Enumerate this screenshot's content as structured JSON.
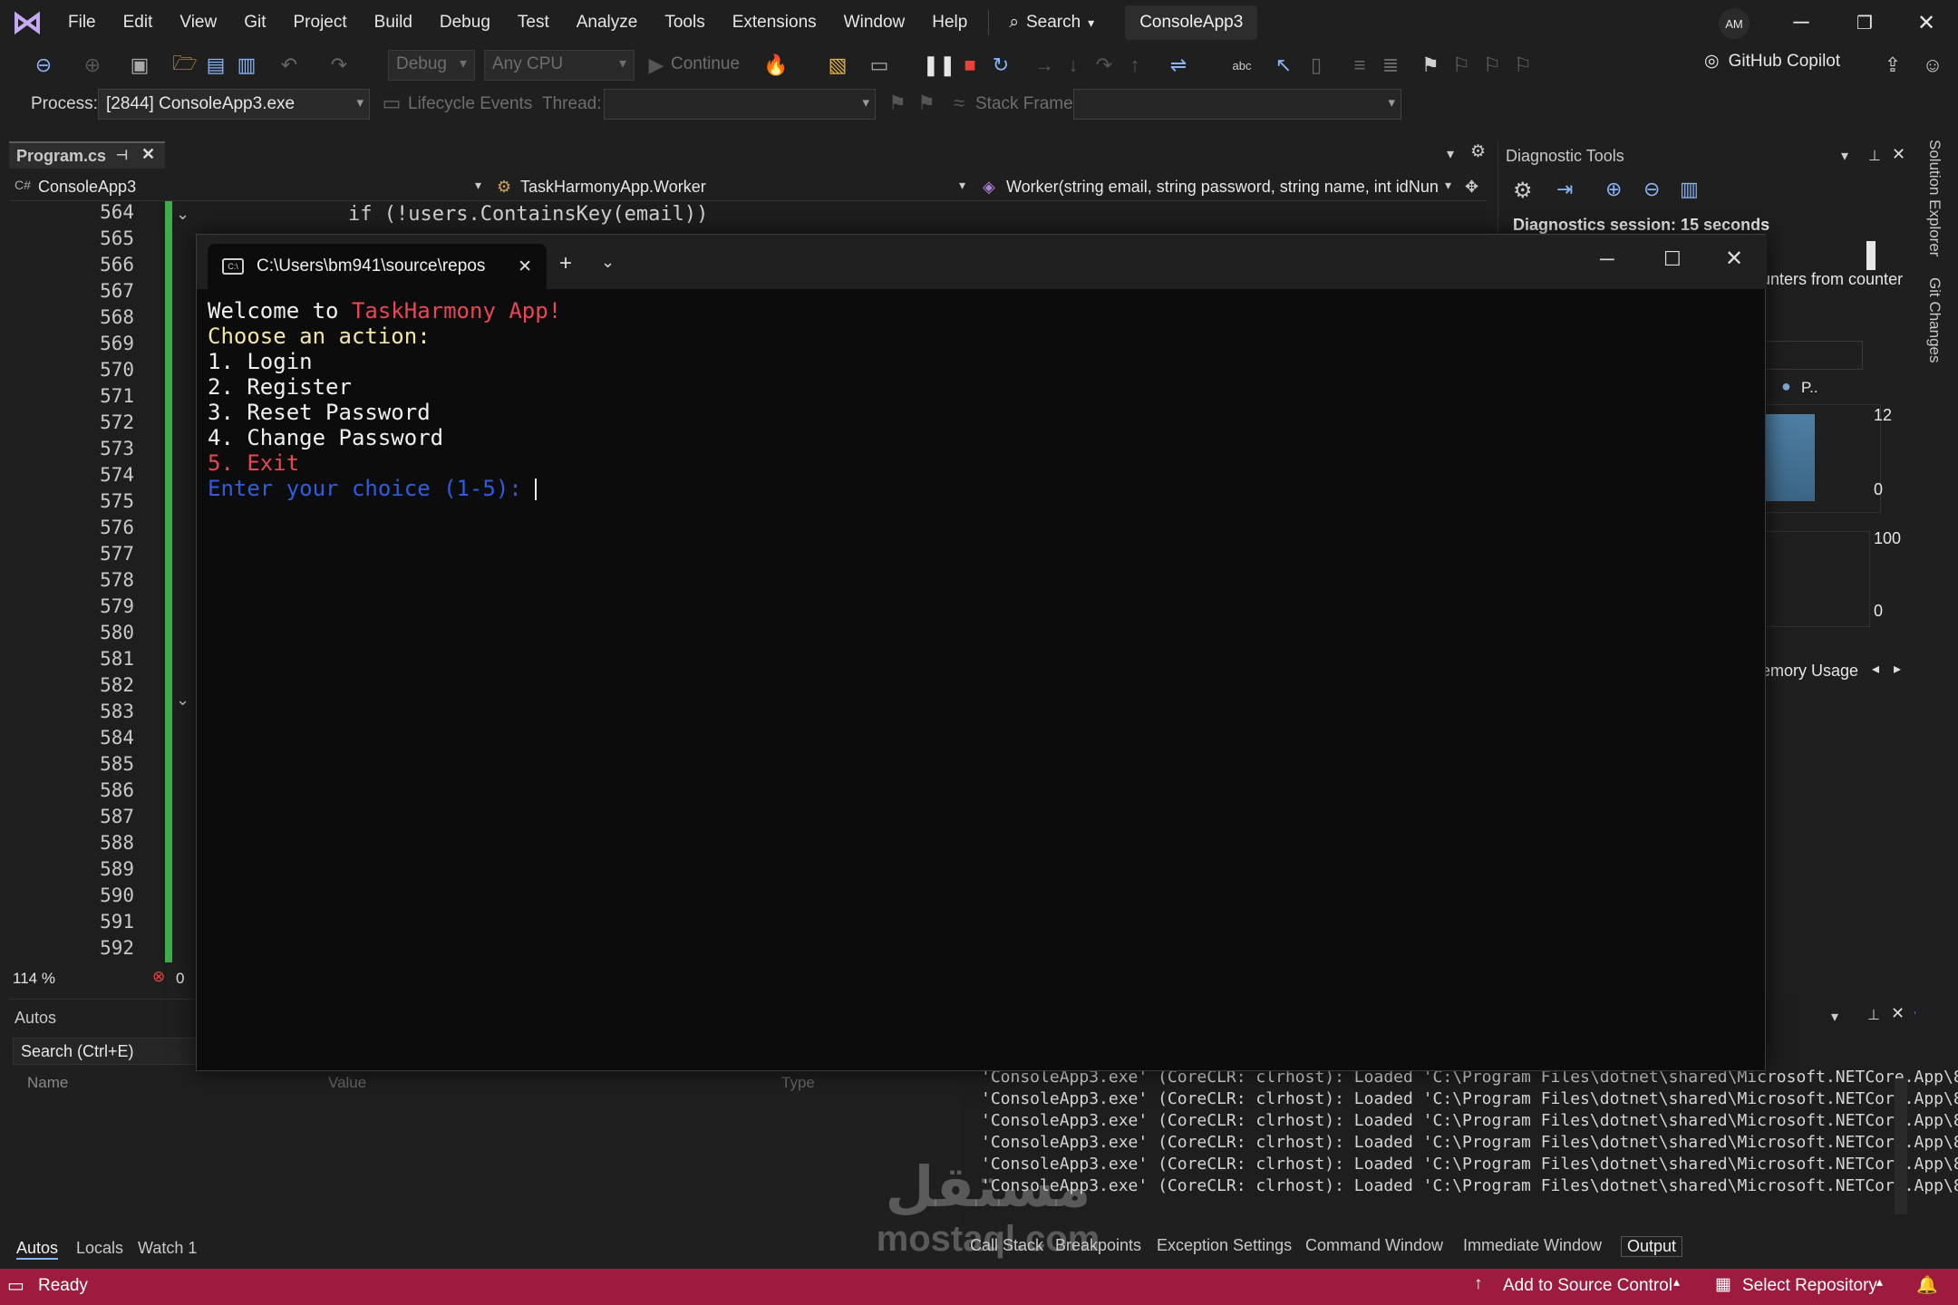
{
  "menu": {
    "items": [
      "File",
      "Edit",
      "View",
      "Git",
      "Project",
      "Build",
      "Debug",
      "Test",
      "Analyze",
      "Tools",
      "Extensions",
      "Window",
      "Help"
    ],
    "search_label": "Search",
    "solution_name": "ConsoleApp3",
    "avatar_initials": "AM"
  },
  "toolbar": {
    "config": "Debug",
    "platform": "Any CPU",
    "continue_label": "Continue",
    "copilot_label": "GitHub Copilot"
  },
  "debug_bar": {
    "process_label": "Process:",
    "process_value": "[2844] ConsoleApp3.exe",
    "lifecycle_label": "Lifecycle Events",
    "thread_label": "Thread:",
    "stack_frame_label": "Stack Frame:"
  },
  "editor": {
    "tab_name": "Program.cs",
    "nav_project": "ConsoleApp3",
    "nav_class": "TaskHarmonyApp.Worker",
    "nav_member": "Worker(string email, string password, string name, int idNun",
    "line_numbers": [
      "564",
      "565",
      "566",
      "567",
      "568",
      "569",
      "570",
      "571",
      "572",
      "573",
      "574",
      "575",
      "576",
      "577",
      "578",
      "579",
      "580",
      "581",
      "582",
      "583",
      "584",
      "585",
      "586",
      "587",
      "588",
      "589",
      "590",
      "591",
      "592"
    ],
    "visible_code": "if (!users.ContainsKey(email))",
    "zoom": "114 %",
    "error_count": "0"
  },
  "console": {
    "tab_title": "C:\\Users\\bm941\\source\\repos",
    "welcome_prefix": "Welcome to ",
    "welcome_app": "TaskHarmony App!",
    "choose": "Choose an action:",
    "options": [
      "1. Login",
      "2. Register",
      "3. Reset Password",
      "4. Change Password"
    ],
    "exit_option": "5. Exit",
    "prompt": "Enter your choice (1-5): "
  },
  "diagnostics": {
    "title": "Diagnostic Tools",
    "session": "Diagnostics session: 15 seconds",
    "counter_text": "unters from counter",
    "legend_item": "P..",
    "axis_top_1": "12",
    "axis_bottom_1": "0",
    "axis_top_2": "100",
    "axis_bottom_2": "0",
    "memory_tab": "emory Usage"
  },
  "side_tabs": [
    "Solution Explorer",
    "Git Changes"
  ],
  "autos": {
    "title": "Autos",
    "search_placeholder": "Search (Ctrl+E)",
    "col_name": "Name",
    "col_value": "Value",
    "col_type": "Type",
    "tabs": [
      "Autos",
      "Locals",
      "Watch 1"
    ]
  },
  "output": {
    "lines": [
      "'ConsoleApp3.exe' (CoreCLR: clrhost): Loaded 'C:\\Program Files\\dotnet\\shared\\Microsoft.NETCore.App\\8",
      "'ConsoleApp3.exe' (CoreCLR: clrhost): Loaded 'C:\\Program Files\\dotnet\\shared\\Microsoft.NETCore.App\\8",
      "'ConsoleApp3.exe' (CoreCLR: clrhost): Loaded 'C:\\Program Files\\dotnet\\shared\\Microsoft.NETCore.App\\8",
      "'ConsoleApp3.exe' (CoreCLR: clrhost): Loaded 'C:\\Program Files\\dotnet\\shared\\Microsoft.NETCore.App\\8",
      "'ConsoleApp3.exe' (CoreCLR: clrhost): Loaded 'C:\\Program Files\\dotnet\\shared\\Microsoft.NETCore.App\\8",
      "'ConsoleApp3.exe' (CoreCLR: clrhost): Loaded 'C:\\Program Files\\dotnet\\shared\\Microsoft.NETCore.App\\8"
    ],
    "tabs": [
      "Call Stack",
      "Breakpoints",
      "Exception Settings",
      "Command Window",
      "Immediate Window",
      "Output"
    ]
  },
  "status": {
    "ready": "Ready",
    "source_control": "Add to Source Control",
    "select_repo": "Select Repository"
  },
  "watermark": {
    "arabic": "مستقل",
    "latin": "mostaql.com"
  },
  "colors": {
    "status_bar": "#9c1b3e",
    "console_red": "#e74856",
    "console_blue": "#2f5ce0",
    "console_yellow": "#f5e6a8",
    "change_bar": "#3fad4a"
  }
}
